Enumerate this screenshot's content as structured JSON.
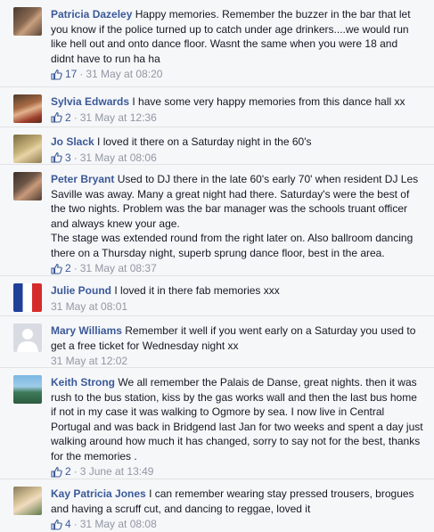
{
  "comments": [
    {
      "author": "Patricia Dazeley",
      "text": "Happy memories. Remember the buzzer in the bar that let you know if the police turned up to catch under age drinkers....we would run like hell out and onto dance floor. Wasnt the same when you were 18 and didnt have to run ha ha",
      "likes": "17",
      "separator": "·",
      "time": "31 May at 08:20",
      "avatar_icon": "profile-photo"
    },
    {
      "author": "Sylvia Edwards",
      "text": "I have some very happy memories from this dance hall xx",
      "likes": "2",
      "separator": "·",
      "time": "31 May at 12:36",
      "avatar_icon": "profile-photo"
    },
    {
      "author": "Jo Slack",
      "text": "I loved it there on a Saturday night in the 60's",
      "likes": "3",
      "separator": "·",
      "time": "31 May at 08:06",
      "avatar_icon": "profile-photo"
    },
    {
      "author": "Peter Bryant",
      "text": "Used to DJ there in the late 60's early 70' when resident DJ Les Saville was away. Many a great night had there. Saturday's were the best of the two nights. Problem was the bar manager was the schools truant officer and always knew your age.",
      "text2": "The stage was extended round from the right later on. Also ballroom dancing there on a Thursday night, superb sprung dance floor, best in the area.",
      "likes": "2",
      "separator": "·",
      "time": "31 May at 08:37",
      "avatar_icon": "profile-photo"
    },
    {
      "author": "Julie Pound",
      "text": "I loved it in there fab memories xxx",
      "time": "31 May at 08:01",
      "avatar_icon": "flag-photo"
    },
    {
      "author": "Mary Williams",
      "text": "Remember it well if you went early on a Saturday you used to get a free ticket for Wednesday night xx",
      "time": "31 May at 12:02",
      "avatar_icon": "default-silhouette-icon"
    },
    {
      "author": "Keith Strong",
      "text": "We all remember the Palais de Danse, great nights. then it was rush to the bus station, kiss by the gas works wall and then the last bus home if not in my case it was walking to Ogmore by sea. I now live in Central Portugal and was back in Bridgend last Jan for two weeks and spent a day just walking around how much it has changed, sorry to say not for the best, thanks for the memories .",
      "likes": "2",
      "separator": "·",
      "time": "3 June at 13:49",
      "avatar_icon": "profile-photo"
    },
    {
      "author": "Kay Patricia Jones",
      "text": "I can remember wearing stay pressed trousers, brogues and having a scruff cut, and dancing to reggae, loved it",
      "likes": "4",
      "separator": "·",
      "time": "31 May at 08:08",
      "avatar_icon": "profile-photo"
    }
  ],
  "colors": {
    "author": "#3b5998",
    "text": "#141823",
    "meta": "#9197a3",
    "background": "#f6f7f9",
    "divider": "#e1e2e3"
  },
  "icons": {
    "like": "thumbs-up-icon"
  }
}
